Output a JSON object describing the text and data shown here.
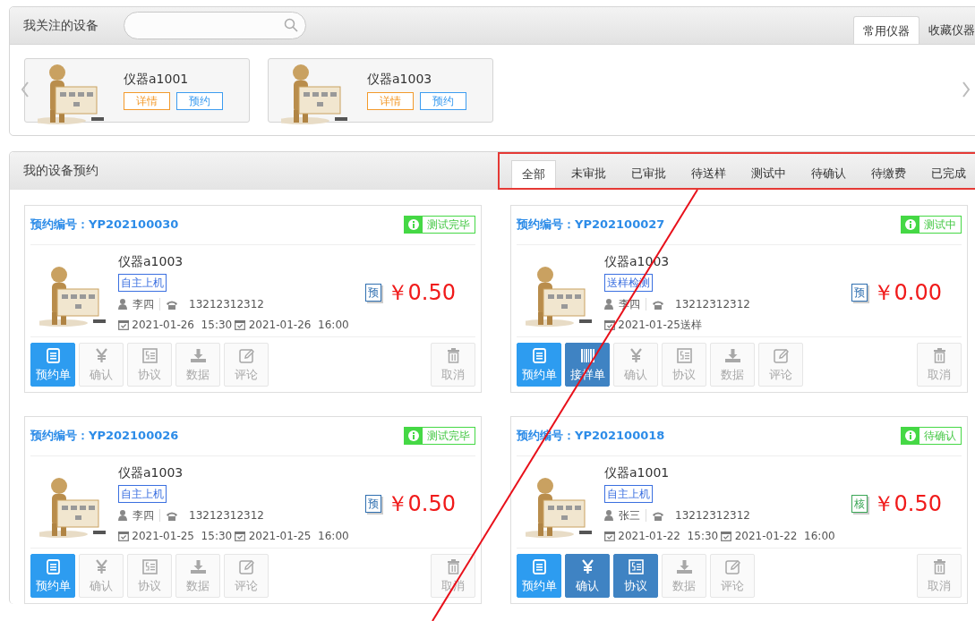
{
  "followed_panel": {
    "title": "我关注的设备",
    "tabs": [
      {
        "label": "常用仪器",
        "selected": true
      },
      {
        "label": "收藏仪器",
        "selected": false
      }
    ],
    "devices": [
      {
        "name": "仪器a1001",
        "detail_button": "详情",
        "reserve_button": "预约"
      },
      {
        "name": "仪器a1003",
        "detail_button": "详情",
        "reserve_button": "预约"
      }
    ]
  },
  "reservations_panel": {
    "title": "我的设备预约",
    "tabs": [
      {
        "label": "全部",
        "selected": true
      },
      {
        "label": "未审批",
        "selected": false
      },
      {
        "label": "已审批",
        "selected": false
      },
      {
        "label": "待送样",
        "selected": false
      },
      {
        "label": "测试中",
        "selected": false
      },
      {
        "label": "待确认",
        "selected": false
      },
      {
        "label": "待缴费",
        "selected": false
      },
      {
        "label": "已完成",
        "selected": false
      }
    ],
    "cards": [
      {
        "number": "预约编号：YP202100030",
        "status": "测试完毕",
        "device": "仪器a1003",
        "mode": "自主上机",
        "person": "李四",
        "phone": "13212312312",
        "times": [
          "2021-01-26  15:30",
          "2021-01-26  16:00"
        ],
        "price_tag": {
          "text": "预",
          "color": "#2f6fb0"
        },
        "price": "￥0.50",
        "buttons": [
          {
            "label": "预约单",
            "kind": "form",
            "disabled": false
          },
          {
            "label": "确认",
            "kind": "confirm",
            "disabled": true
          },
          {
            "label": "协议",
            "kind": "agreement",
            "disabled": true
          },
          {
            "label": "数据",
            "kind": "data",
            "disabled": true
          },
          {
            "label": "评论",
            "kind": "review",
            "disabled": true
          },
          {
            "label": "取消",
            "kind": "cancel",
            "disabled": true
          }
        ]
      },
      {
        "number": "预约编号：YP202100027",
        "status": "测试中",
        "device": "仪器a1003",
        "mode": "送样检测",
        "person": "李四",
        "phone": "13212312312",
        "times": [
          "2021-01-25送样"
        ],
        "price_tag": {
          "text": "预",
          "color": "#2f6fb0"
        },
        "price": "￥0.00",
        "buttons": [
          {
            "label": "预约单",
            "kind": "form",
            "disabled": false
          },
          {
            "label": "接样单",
            "kind": "sample",
            "disabled": false
          },
          {
            "label": "确认",
            "kind": "confirm",
            "disabled": true
          },
          {
            "label": "协议",
            "kind": "agreement",
            "disabled": true
          },
          {
            "label": "数据",
            "kind": "data",
            "disabled": true
          },
          {
            "label": "评论",
            "kind": "review",
            "disabled": true
          },
          {
            "label": "取消",
            "kind": "cancel",
            "disabled": true
          }
        ]
      },
      {
        "number": "预约编号：YP202100026",
        "status": "测试完毕",
        "device": "仪器a1003",
        "mode": "自主上机",
        "person": "李四",
        "phone": "13212312312",
        "times": [
          "2021-01-25  15:30",
          "2021-01-25  16:00"
        ],
        "price_tag": {
          "text": "预",
          "color": "#2f6fb0"
        },
        "price": "￥0.50",
        "buttons": [
          {
            "label": "预约单",
            "kind": "form",
            "disabled": false
          },
          {
            "label": "确认",
            "kind": "confirm",
            "disabled": true
          },
          {
            "label": "协议",
            "kind": "agreement",
            "disabled": true
          },
          {
            "label": "数据",
            "kind": "data",
            "disabled": true
          },
          {
            "label": "评论",
            "kind": "review",
            "disabled": true
          },
          {
            "label": "取消",
            "kind": "cancel",
            "disabled": true
          }
        ]
      },
      {
        "number": "预约编号：YP202100018",
        "status": "待确认",
        "device": "仪器a1001",
        "mode": "自主上机",
        "person": "张三",
        "phone": "13212312312",
        "times": [
          "2021-01-22  15:30",
          "2021-01-22  16:00"
        ],
        "price_tag": {
          "text": "核",
          "color": "#3aa655"
        },
        "price": "￥0.50",
        "buttons": [
          {
            "label": "预约单",
            "kind": "form",
            "disabled": false
          },
          {
            "label": "确认",
            "kind": "confirm",
            "disabled": false
          },
          {
            "label": "协议",
            "kind": "agreement",
            "disabled": false
          },
          {
            "label": "数据",
            "kind": "data",
            "disabled": true
          },
          {
            "label": "评论",
            "kind": "review",
            "disabled": true
          },
          {
            "label": "取消",
            "kind": "cancel",
            "disabled": true
          }
        ]
      }
    ]
  }
}
